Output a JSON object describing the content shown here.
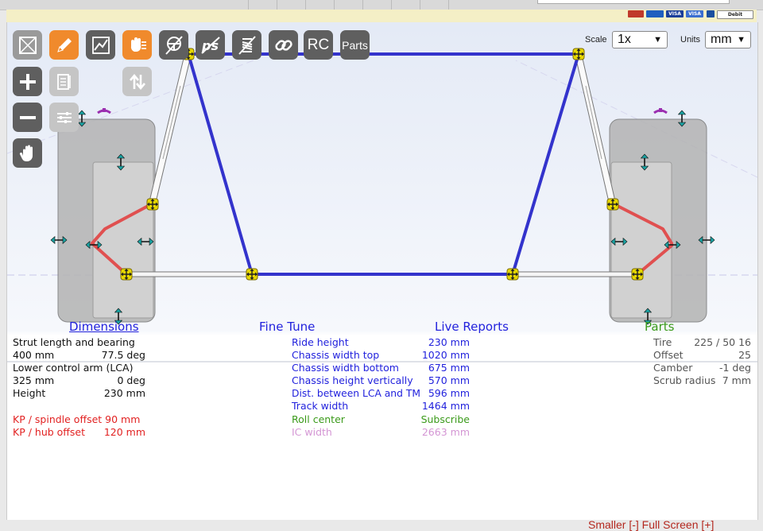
{
  "toolbar": {
    "rc_label": "RC",
    "parts_label": "Parts",
    "scale_label": "Scale",
    "scale_value": "1x",
    "units_label": "Units",
    "units_value": "mm"
  },
  "payment_cards": [
    "VISA",
    "VISA",
    "Debit"
  ],
  "dimensions": {
    "title": "Dimensions",
    "strut_label": "Strut length and bearing",
    "strut_length": "400 mm",
    "strut_bearing": "77.5 deg",
    "lca_label": "Lower control arm (LCA)",
    "lca_length": "325 mm",
    "lca_angle": "0 deg",
    "height_label": "Height",
    "height_value": "230 mm",
    "kp_spindle": "KP / spindle offset 90 mm",
    "kp_hub_label": "KP / hub offset",
    "kp_hub_value": "120 mm"
  },
  "fine_tune": {
    "title": "Fine Tune",
    "items": [
      {
        "label": "Ride height",
        "value": "230 mm"
      },
      {
        "label": "Chassis width top",
        "value": "1020 mm"
      },
      {
        "label": "Chassis width bottom",
        "value": "675 mm"
      },
      {
        "label": "Chassis height vertically",
        "value": "570 mm"
      },
      {
        "label": "Dist. between LCA and TM",
        "value": "596 mm"
      },
      {
        "label": "Track width",
        "value": "1464 mm"
      }
    ],
    "roll_center_label": "Roll center",
    "roll_center_value": "Subscribe",
    "ic_width_label": "IC width",
    "ic_width_value": "2663 mm"
  },
  "live_reports": {
    "title": "Live Reports"
  },
  "parts": {
    "title": "Parts",
    "tire_label": "Tire",
    "tire_value": "225 / 50 16",
    "offset_label": "Offset",
    "offset_value": "25",
    "camber_label": "Camber",
    "camber_value": "-1 deg",
    "scrub_label": "Scrub radius",
    "scrub_value": "7 mm"
  },
  "footer": {
    "text": "Smaller [-]  Full Screen [+]"
  },
  "colors": {
    "chassis": "#3333cc",
    "control_arm": "#e05050",
    "joint": "#e8d800",
    "handle": "#1aa3a3",
    "camber_marker": "#9b2fb0",
    "tool_orange": "#f08a2c",
    "tool_dark": "#5f5f5f"
  }
}
